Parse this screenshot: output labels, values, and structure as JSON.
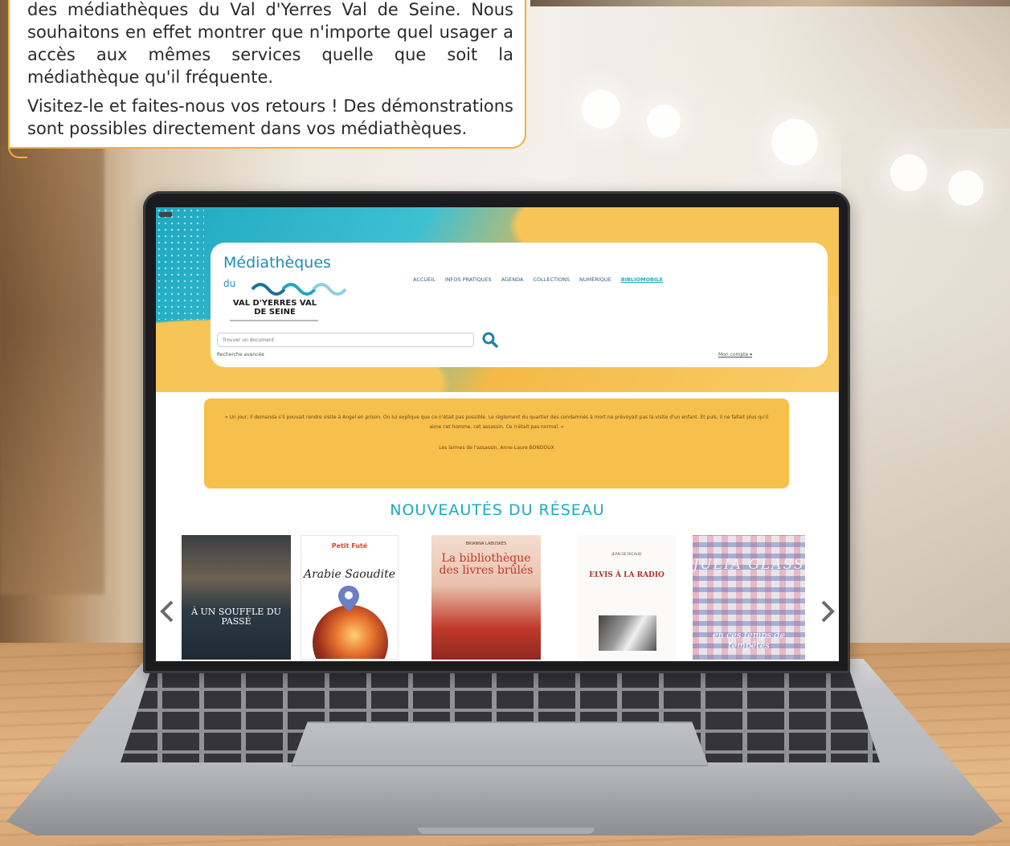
{
  "article": {
    "line1": "des médiathèques du Val d'Yerres Val de Seine. Nous souhaitons en effet montrer que n'importe quel usager a accès aux mêmes services quelle que soit la médiathèque qu'il fréquente.",
    "line2": "Visitez-le et faites-nous vos retours ! Des démonstrations sont possibles directement dans vos médiathèques."
  },
  "site": {
    "logo": {
      "title": "Médiathèques",
      "du": "du",
      "name": "VAL D'YERRES VAL DE SEINE"
    },
    "nav": [
      "ACCUEIL",
      "INFOS PRATIQUES",
      "AGENDA",
      "COLLECTIONS",
      "NUMÉRIQUE",
      "BIBLIOMOBILE"
    ],
    "search_placeholder": "Trouver un document",
    "advanced_search": "Recherche avancée",
    "account": "Mon compte ▾",
    "quote": {
      "text": "« Un jour, il demanda s'il pouvait rendre visite à Angel en prison. On lui explique que ce n'était pas possible. Le règlement du quartier des condamnés à mort ne prévoyait pas la visite d'un enfant. Et puis, il ne fallait plus qu'il aime cet homme, cet assassin. Ce n'était pas normal. »",
      "source": "Les larmes de l'assassin, Anne-Laure BONDOUX"
    },
    "section_title": "NOUVEAUTÉS DU RÉSEAU",
    "books": [
      {
        "title": "À UN SOUFFLE DU PASSÉ"
      },
      {
        "brand": "Petit Futé",
        "title": "Arabie Saoudite"
      },
      {
        "author": "BRIANNA LABUSKES",
        "title": "La bibliothèque des livres brûlés"
      },
      {
        "author": "JEAN DE RICAUD",
        "title": "ELVIS À LA RADIO"
      },
      {
        "title": "JULIA GLASS",
        "subtitle": "en ces temps de tempêtes"
      }
    ]
  },
  "colors": {
    "accent_orange": "#f5b03a",
    "site_teal": "#1ea9c1",
    "site_yellow": "#f7bf4c"
  }
}
